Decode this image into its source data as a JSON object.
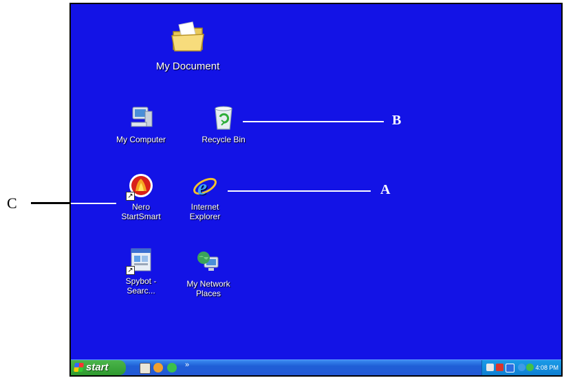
{
  "desktop": {
    "icons": {
      "my_document": "My Document",
      "my_computer": "My Computer",
      "recycle_bin": "Recycle Bin",
      "nero": "Nero\nStartSmart",
      "internet_explorer": "Internet\nExplorer",
      "spybot": "Spybot -\nSearc...",
      "my_network_places": "My Network\nPlaces"
    },
    "background_color": "#1313e6"
  },
  "callouts": {
    "a": "A",
    "b": "B",
    "c": "C"
  },
  "taskbar": {
    "start_label": "start",
    "overflow_chevron": "»",
    "clock": "4:08 PM",
    "quick_launch_icons": [
      "show-desktop-icon",
      "media-player-icon",
      "browser-icon"
    ],
    "tray_icons": [
      "network-icon",
      "security-icon",
      "help-icon",
      "update-icon",
      "messenger-icon"
    ]
  }
}
